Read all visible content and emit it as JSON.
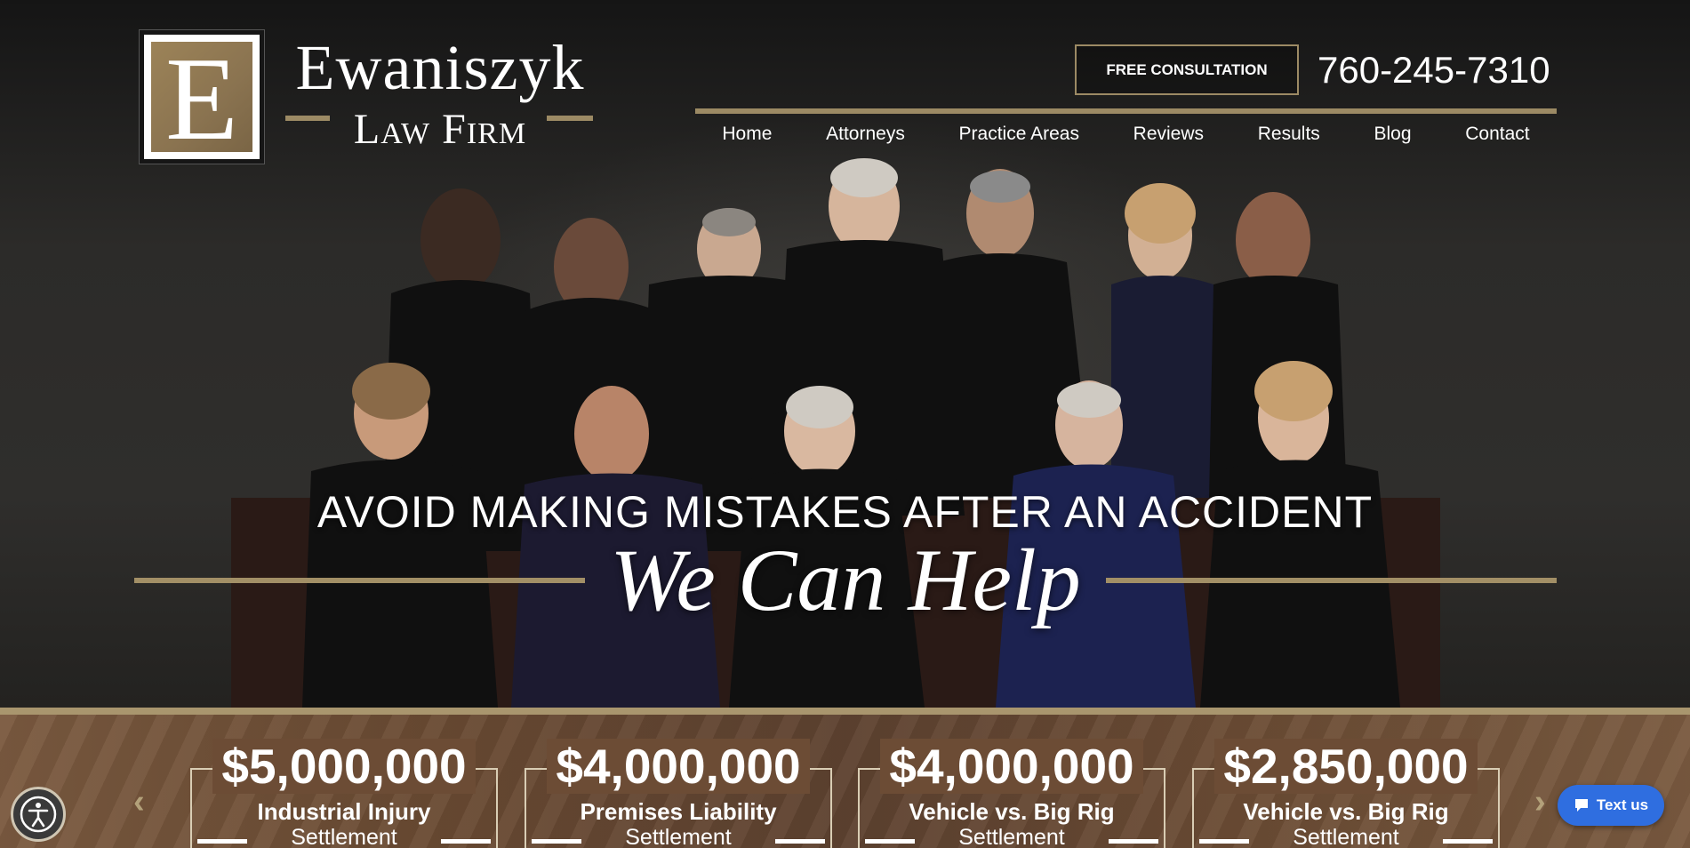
{
  "logo": {
    "initial": "E",
    "name": "Ewaniszyk",
    "subtitle": "Law Firm"
  },
  "header": {
    "consult_label": "FREE CONSULTATION",
    "phone": "760-245-7310"
  },
  "nav": {
    "items": [
      {
        "label": "Home"
      },
      {
        "label": "Attorneys"
      },
      {
        "label": "Practice Areas"
      },
      {
        "label": "Reviews"
      },
      {
        "label": "Results"
      },
      {
        "label": "Blog"
      },
      {
        "label": "Contact"
      }
    ]
  },
  "hero": {
    "tagline": "AVOID MAKING MISTAKES AFTER AN ACCIDENT",
    "headline": "We Can Help"
  },
  "results": [
    {
      "amount": "$5,000,000",
      "type": "Industrial Injury",
      "kind": "Settlement"
    },
    {
      "amount": "$4,000,000",
      "type": "Premises Liability",
      "kind": "Settlement"
    },
    {
      "amount": "$4,000,000",
      "type": "Vehicle vs. Big Rig",
      "kind": "Settlement"
    },
    {
      "amount": "$2,850,000",
      "type": "Vehicle vs. Big Rig",
      "kind": "Settlement"
    }
  ],
  "widgets": {
    "text_us_label": "Text us",
    "prev_arrow": "‹",
    "next_arrow": "›"
  },
  "colors": {
    "gold": "#9c8a64",
    "text_us_blue": "#2f6ee0"
  }
}
